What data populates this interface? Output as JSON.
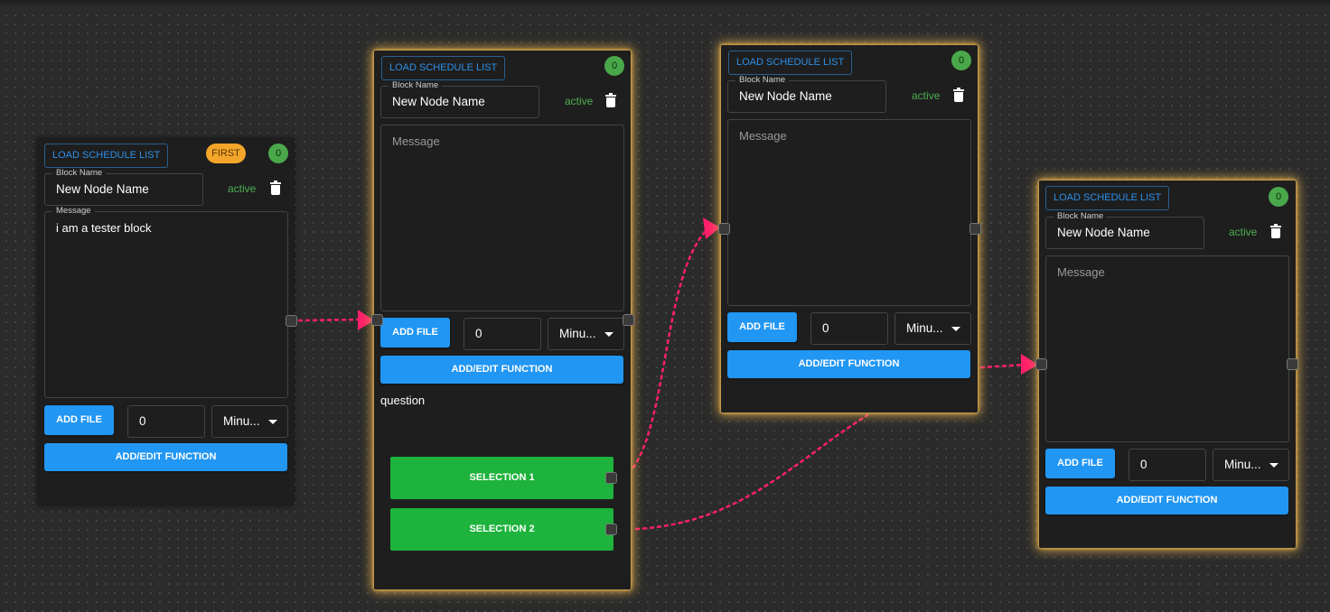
{
  "nodes": [
    {
      "load_label": "LOAD SCHEDULE LIST",
      "first_label": "FIRST",
      "count": "0",
      "block_name_label": "Block Name",
      "block_name_value": "New Node Name",
      "status": "active",
      "message_label": "Message",
      "message_value": "i am a tester block",
      "add_file_label": "ADD FILE",
      "number_value": "0",
      "unit_value": "Minu...",
      "function_label": "ADD/EDIT FUNCTION"
    },
    {
      "load_label": "LOAD SCHEDULE LIST",
      "count": "0",
      "block_name_label": "Block Name",
      "block_name_value": "New Node Name",
      "status": "active",
      "message_placeholder": "Message",
      "add_file_label": "ADD FILE",
      "number_value": "0",
      "unit_value": "Minu...",
      "function_label": "ADD/EDIT FUNCTION",
      "question": "question",
      "selections": [
        "SELECTION 1",
        "SELECTION 2"
      ]
    },
    {
      "load_label": "LOAD SCHEDULE LIST",
      "count": "0",
      "block_name_label": "Block Name",
      "block_name_value": "New Node Name",
      "status": "active",
      "message_placeholder": "Message",
      "add_file_label": "ADD FILE",
      "number_value": "0",
      "unit_value": "Minu...",
      "function_label": "ADD/EDIT FUNCTION"
    },
    {
      "load_label": "LOAD SCHEDULE LIST",
      "count": "0",
      "block_name_label": "Block Name",
      "block_name_value": "New Node Name",
      "status": "active",
      "message_placeholder": "Message",
      "add_file_label": "ADD FILE",
      "number_value": "0",
      "unit_value": "Minu...",
      "function_label": "ADD/EDIT FUNCTION"
    }
  ],
  "colors": {
    "canvas": "#2b2b2b",
    "node": "#1e1e1e",
    "accent_blue": "#2196f3",
    "active_green": "#4caf50",
    "selection_green": "#1db33c",
    "first_badge": "#f4a62a",
    "count_badge": "#4aa84a",
    "connector": "#ff1f6b",
    "selected_glow": "#f0b950"
  },
  "icons": [
    "trash-icon",
    "caret-down-icon",
    "arrowhead-icon"
  ]
}
